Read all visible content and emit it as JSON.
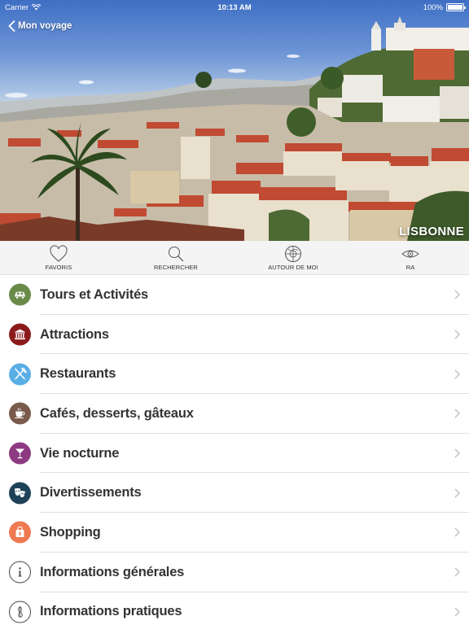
{
  "status_bar": {
    "carrier": "Carrier",
    "time": "10:13 AM",
    "battery": "100%",
    "battery_level": 1.0
  },
  "header": {
    "back_label": "Mon voyage",
    "city": "LISBONNE"
  },
  "tabs": [
    {
      "label": "FAVORIS",
      "icon": "heart-icon"
    },
    {
      "label": "RECHERCHER",
      "icon": "search-icon"
    },
    {
      "label": "AUTOUR DE MOI",
      "icon": "crosshair-globe-icon"
    },
    {
      "label": "RA",
      "icon": "eye-icon"
    }
  ],
  "menu": [
    {
      "label": "Tours et Activités",
      "icon": "tour-car-icon",
      "color": "#6a8a4a"
    },
    {
      "label": "Attractions",
      "icon": "monument-icon",
      "color": "#8b1a1a"
    },
    {
      "label": "Restaurants",
      "icon": "fork-knife-icon",
      "color": "#5aaee6"
    },
    {
      "label": "Cafés, desserts, gâteaux",
      "icon": "coffee-cup-icon",
      "color": "#7a5a4a"
    },
    {
      "label": "Vie nocturne",
      "icon": "cocktail-icon",
      "color": "#8e3a82"
    },
    {
      "label": "Divertissements",
      "icon": "theater-masks-icon",
      "color": "#1f4258"
    },
    {
      "label": "Shopping",
      "icon": "shopping-bag-icon",
      "color": "#ee7a52"
    },
    {
      "label": "Informations générales",
      "icon": "info-icon",
      "color": "#ffffff"
    },
    {
      "label": "Informations pratiques",
      "icon": "practical-info-icon",
      "color": "#ffffff"
    }
  ]
}
